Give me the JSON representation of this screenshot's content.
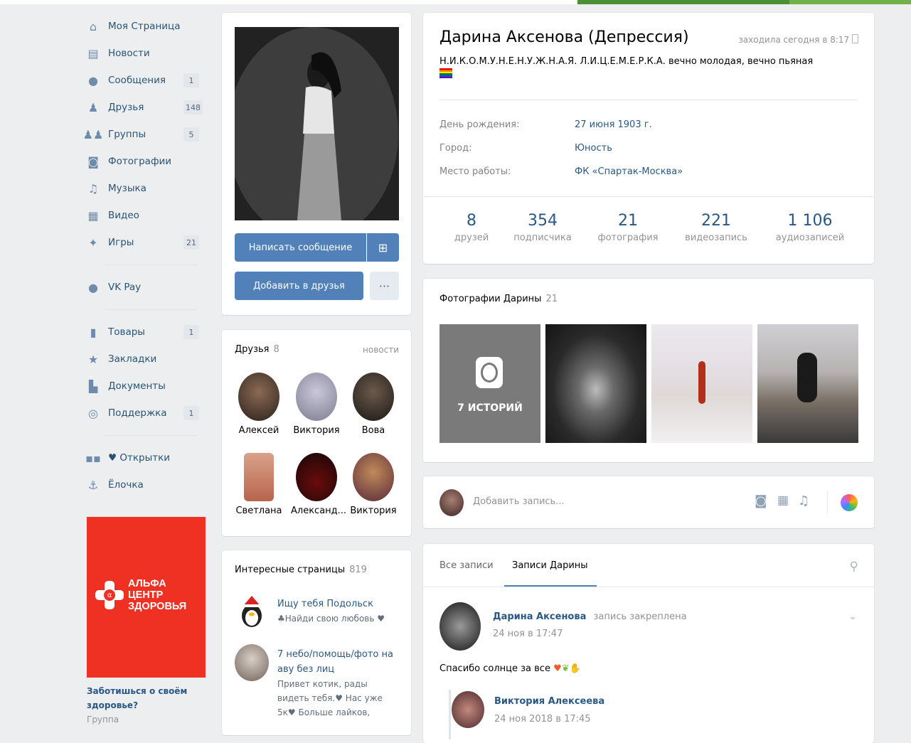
{
  "sidebar": {
    "items": [
      {
        "label": "Моя Страница",
        "icon": "home-icon"
      },
      {
        "label": "Новости",
        "icon": "news-icon"
      },
      {
        "label": "Сообщения",
        "icon": "messages-icon",
        "count": "1"
      },
      {
        "label": "Друзья",
        "icon": "friends-icon",
        "count": "148"
      },
      {
        "label": "Группы",
        "icon": "groups-icon",
        "count": "5"
      },
      {
        "label": "Фотографии",
        "icon": "photos-icon"
      },
      {
        "label": "Музыка",
        "icon": "music-icon"
      },
      {
        "label": "Видео",
        "icon": "video-icon"
      },
      {
        "label": "Игры",
        "icon": "games-icon",
        "count": "21"
      }
    ],
    "pay": {
      "label": "VK Pay",
      "icon": "vkpay-icon"
    },
    "items2": [
      {
        "label": "Товары",
        "icon": "goods-icon",
        "count": "1"
      },
      {
        "label": "Закладки",
        "icon": "bookmarks-icon"
      },
      {
        "label": "Документы",
        "icon": "documents-icon"
      },
      {
        "label": "Поддержка",
        "icon": "support-icon",
        "count": "1"
      }
    ],
    "items3": [
      {
        "label": "♥ Открытки",
        "icon": "apps-icon"
      },
      {
        "label": "Ёлочка",
        "icon": "anchor-icon"
      }
    ]
  },
  "ad": {
    "logo_text": "АЛЬФА ЦЕНТР ЗДОРОВЬЯ",
    "logo_line1": "АЛЬФА",
    "logo_line2": "ЦЕНТР",
    "logo_line3": "ЗДОРОВЬЯ",
    "caption": "Заботишься о своём здоровье?",
    "sub": "Группа"
  },
  "profile": {
    "write_message": "Написать сообщение",
    "add_friend": "Добавить в друзья",
    "more": "···"
  },
  "friends_block": {
    "title": "Друзья",
    "count": "8",
    "link": "новости",
    "people": [
      "Алексей",
      "Виктория",
      "Вова",
      "Светлана",
      "Александ...",
      "Виктория"
    ]
  },
  "pages_block": {
    "title": "Интересные страницы",
    "count": "819",
    "items": [
      {
        "title": "Ищу тебя Подольск",
        "sub": "♣Найди свою любовь ♥"
      },
      {
        "title": "7 небо/помощь/фото на аву без лиц",
        "sub": "Привет котик, рады видеть тебя.♥ Нас уже 5к♥ Больше лайков,"
      }
    ]
  },
  "info": {
    "name": "Дарина Аксенова (Депрессия)",
    "online": "заходила сегодня в 8:17",
    "status": "Н.И.К.О.М.У.Н.Е.Н.У.Ж.Н.А.Я. Л.И.Ц.Е.М.Е.Р.К.А. вечно молодая, вечно пьяная",
    "rows": [
      {
        "k": "День рождения:",
        "v": "27 июня 1903 г."
      },
      {
        "k": "Город:",
        "v": "Юность"
      },
      {
        "k": "Место работы:",
        "v": "ФК «Спартак-Москва»"
      }
    ],
    "stats": [
      {
        "num": "8",
        "lab": "друзей"
      },
      {
        "num": "354",
        "lab": "подписчика"
      },
      {
        "num": "21",
        "lab": "фотография"
      },
      {
        "num": "221",
        "lab": "видеозапись"
      },
      {
        "num": "1 106",
        "lab": "аудиозаписей"
      }
    ]
  },
  "photos": {
    "title": "Фотографии Дарины",
    "count": "21",
    "stories": "7 ИСТОРИЙ"
  },
  "compose": {
    "placeholder": "Добавить запись..."
  },
  "wall": {
    "tabs": [
      "Все записи",
      "Записи Дарины"
    ],
    "post": {
      "author": "Дарина Аксенова",
      "pinned": "запись закреплена",
      "date": "24 ноя в 17:47",
      "text": "Спасибо солнце за все"
    },
    "comment": {
      "author": "Виктория Алексеева",
      "date": "24 ноя 2018 в 17:45"
    }
  },
  "colors": {
    "accent": "#5181b8",
    "link": "#2a5885",
    "background": "#edeef0",
    "ad_red": "#ef3124"
  }
}
